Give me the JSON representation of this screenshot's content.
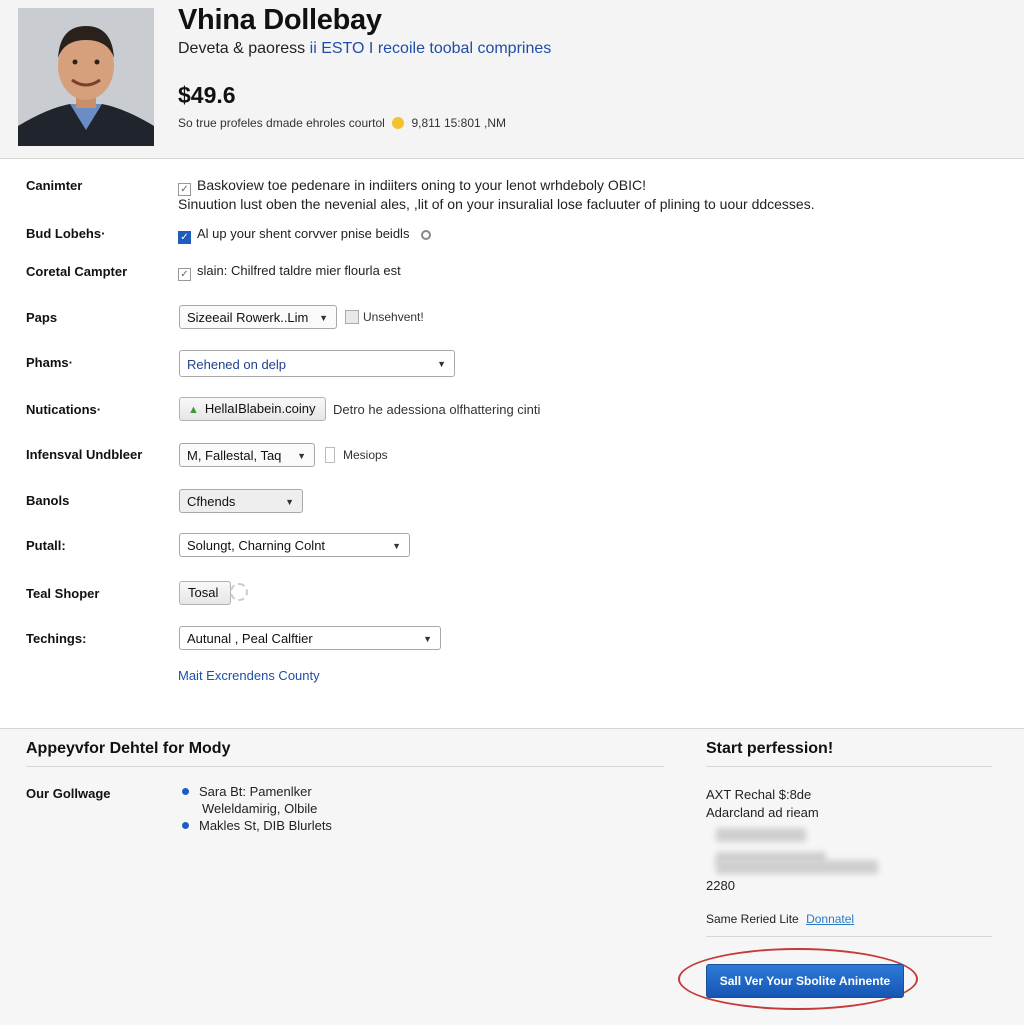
{
  "header": {
    "name": "Vhina Dollebay",
    "subtitle_prefix": "Deveta & paoress",
    "subtitle_sep": "ESTO",
    "subtitle_link": "recoile toobal comprines",
    "price": "$49.6",
    "meta_left": "So true profeles dmade ehroles courtol",
    "meta_right": "9,811 15:801 ,NM"
  },
  "form": {
    "rows": [
      {
        "label": "Canimter",
        "line1": "Baskoview toe pedenare in indiiters oning to your lenot wrhdeboly OBIC!",
        "line2": "Sinuution lust oben the nevenial ales, ,lit of on your insuralial lose facluuter of plining to uour ddcesses."
      },
      {
        "label": "Bud Lobehs·",
        "text": "Al up your shent corvver pnise beidls"
      },
      {
        "label": "Coretal Campter",
        "text": "slain: Chilfred taldre mier flourla est"
      },
      {
        "label": "Paps",
        "select": "Sizeeail Rowerk..Lim",
        "aside": "Unsehvent!"
      },
      {
        "label": "Phams·",
        "select": "Rehened on delp"
      },
      {
        "label": "Nutications·",
        "select": "HellaIBlabein.coiny",
        "aside": "Detro he adessiona olfhattering cinti"
      },
      {
        "label": "Infensval Undbleer",
        "select": "M, Fallestal, Taq",
        "aside": "Mesiops"
      },
      {
        "label": "Banols",
        "select": "Cfhends"
      },
      {
        "label": "Putall:",
        "select": "Solungt, Charning Colnt"
      },
      {
        "label": "Teal Shoper",
        "button": "Tosal"
      },
      {
        "label": "Techings:",
        "select": "Autunal , Peal Calftier"
      }
    ],
    "link": "Mait Excrendens County"
  },
  "footer": {
    "left_title": "Appeyvfor Dehtel for Mody",
    "left_label": "Our Gollwage",
    "items": [
      "Sara Bt: Pamenlker",
      "Weleldamirig, Olbile",
      "Makles St, DIB Blurlets"
    ],
    "right_title": "Start perfession!",
    "right_line1": "AXT Rechal $:8de",
    "right_line2": "Adarcland ad rieam",
    "right_num": "2280",
    "right_note": "Same Reried Lite",
    "right_note_link": "Donnatel",
    "cta": "Sall Ver Your Sbolite Aninente"
  }
}
